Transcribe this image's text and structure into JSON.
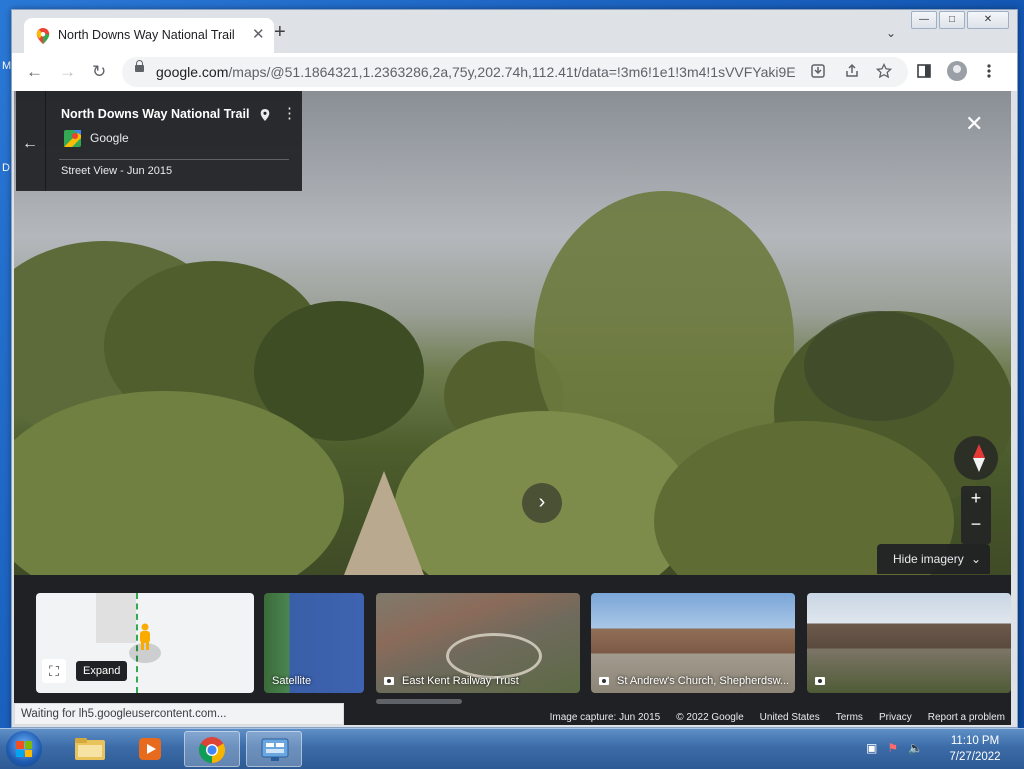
{
  "desktop": {
    "edge_letters": [
      "M",
      "D"
    ]
  },
  "browser": {
    "tab": {
      "title": "North Downs Way National Trail",
      "close": "✕"
    },
    "new_tab": "+",
    "tab_dropdown": "⌄",
    "window_buttons": {
      "minimize": "—",
      "maximize": "□",
      "close": "✕"
    },
    "nav": {
      "back": "←",
      "forward": "→",
      "reload": "↻"
    },
    "url_host": "google.com",
    "url_path": "/maps/@51.1864321,1.2363286,2a,75y,202.74h,112.41t/data=!3m6!1e1!3m4!1sVVFYaki9Ef...",
    "toolbar_icons": [
      "install-icon",
      "share-icon",
      "bookmark-star-icon",
      "side-panel-icon",
      "profile-icon",
      "menu-icon"
    ],
    "status_text": "Waiting for lh5.googleusercontent.com..."
  },
  "maps": {
    "card": {
      "title": "North Downs Way National Trail",
      "provider": "Google",
      "date": "Street View - Jun 2015",
      "back": "←",
      "more": "⋮"
    },
    "close": "✕",
    "zoom_in": "+",
    "zoom_out": "−",
    "next_arrow": "›",
    "hide_imagery": "Hide imagery",
    "filmstrip": {
      "expand_tooltip": "Expand",
      "thumbs": [
        {
          "label": "Satellite"
        },
        {
          "label": "East Kent Railway Trust"
        },
        {
          "label": "St Andrew's Church, Shepherdsw..."
        },
        {
          "label": ""
        }
      ]
    },
    "footer": {
      "capture": "Image capture: Jun 2015",
      "copyright": "© 2022 Google",
      "region": "United States",
      "terms": "Terms",
      "privacy": "Privacy",
      "report": "Report a problem"
    }
  },
  "taskbar": {
    "clock_time": "11:10 PM",
    "clock_date": "7/27/2022",
    "apps": [
      "windows-explorer",
      "media-player",
      "chrome",
      "control-panel"
    ]
  },
  "colors": {
    "accent": "#1a73e8",
    "maps_dark": "#202124",
    "taskbar": "#3c6ca8"
  }
}
